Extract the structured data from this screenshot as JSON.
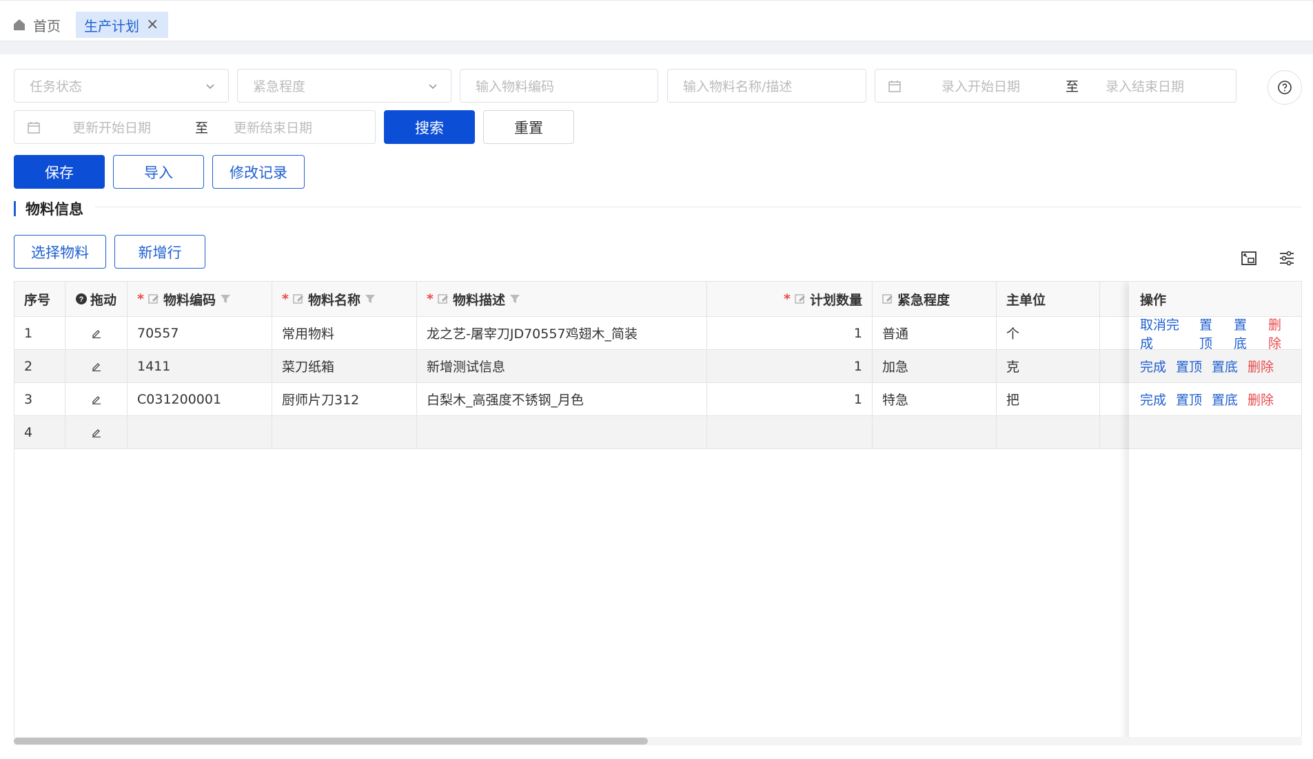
{
  "tabs": {
    "home_label": "首页",
    "active_label": "生产计划"
  },
  "filters": {
    "task_status_placeholder": "任务状态",
    "urgency_placeholder": "紧急程度",
    "material_code_placeholder": "输入物料编码",
    "material_name_placeholder": "输入物料名称/描述",
    "entry_start_placeholder": "录入开始日期",
    "entry_end_placeholder": "录入结束日期",
    "update_start_placeholder": "更新开始日期",
    "update_end_placeholder": "更新结束日期",
    "range_separator": "至"
  },
  "buttons": {
    "search": "搜索",
    "reset": "重置",
    "save": "保存",
    "import": "导入",
    "history": "修改记录",
    "select_material": "选择物料",
    "add_row": "新增行"
  },
  "section": {
    "title": "物料信息"
  },
  "table": {
    "headers": {
      "index": "序号",
      "drag": "拖动",
      "code": "物料编码",
      "name": "物料名称",
      "desc": "物料描述",
      "qty": "计划数量",
      "urgency": "紧急程度",
      "unit": "主单位",
      "ops": "操作"
    },
    "required_mark": "*",
    "rows": [
      {
        "index": "1",
        "code": "70557",
        "name": "常用物料",
        "desc": "龙之艺-屠宰刀JD70557鸡翅木_简装",
        "qty": "1",
        "urgency": "普通",
        "unit": "个"
      },
      {
        "index": "2",
        "code": "1411",
        "name": "菜刀纸箱",
        "desc": "新增测试信息",
        "qty": "1",
        "urgency": "加急",
        "unit": "克"
      },
      {
        "index": "3",
        "code": "C031200001",
        "name": "厨师片刀312",
        "desc": "白梨木_高强度不锈钢_月色",
        "qty": "1",
        "urgency": "特急",
        "unit": "把"
      },
      {
        "index": "4",
        "code": "",
        "name": "",
        "desc": "",
        "qty": "",
        "urgency": "",
        "unit": ""
      }
    ],
    "ops": [
      [
        "取消完成",
        "置顶",
        "置底",
        "删除"
      ],
      [
        "完成",
        "置顶",
        "置底",
        "删除"
      ],
      [
        "完成",
        "置顶",
        "置底",
        "删除"
      ],
      []
    ]
  },
  "colors": {
    "primary": "#0c4fd6",
    "link": "#1f5fd0",
    "danger": "#e84a4a"
  }
}
